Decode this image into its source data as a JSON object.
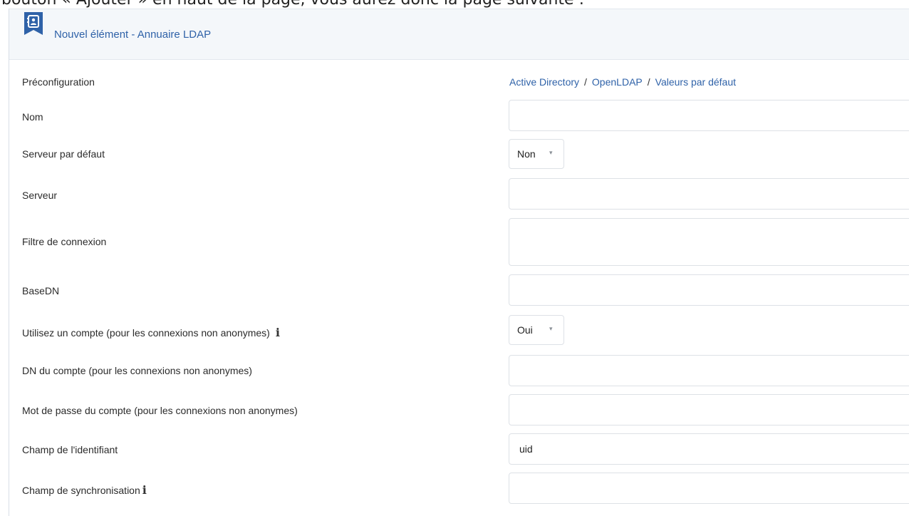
{
  "caption": "bouton « Ajouter » en haut de la page, vous aurez donc la page suivante :",
  "header": {
    "title": "Nouvel élément - Annuaire LDAP",
    "icon": "address-book-icon"
  },
  "preconfiguration": {
    "label": "Préconfiguration",
    "links": [
      "Active Directory",
      "OpenLDAP",
      "Valeurs par défaut"
    ],
    "separator": "/"
  },
  "fields": {
    "nom": {
      "label": "Nom",
      "value": ""
    },
    "serveur_defaut": {
      "label": "Serveur par défaut",
      "value": "Non"
    },
    "serveur": {
      "label": "Serveur",
      "value": ""
    },
    "filtre": {
      "label": "Filtre de connexion",
      "value": ""
    },
    "basedn": {
      "label": "BaseDN",
      "value": ""
    },
    "utiliser_compte": {
      "label": "Utilisez un compte (pour les connexions non anonymes)",
      "value": "Oui"
    },
    "dn_compte": {
      "label": "DN du compte (pour les connexions non anonymes)",
      "value": ""
    },
    "mdp_compte": {
      "label": "Mot de passe du compte (pour les connexions non anonymes)",
      "value": ""
    },
    "champ_identifiant": {
      "label": "Champ de l'identifiant",
      "value": "uid"
    },
    "champ_sync": {
      "label": "Champ de synchronisation",
      "value": ""
    }
  },
  "info_glyph": "i",
  "select_caret": "▾",
  "colors": {
    "link": "#2f62a8",
    "header_bg": "#f4f7fa",
    "border": "#dde1e6"
  }
}
